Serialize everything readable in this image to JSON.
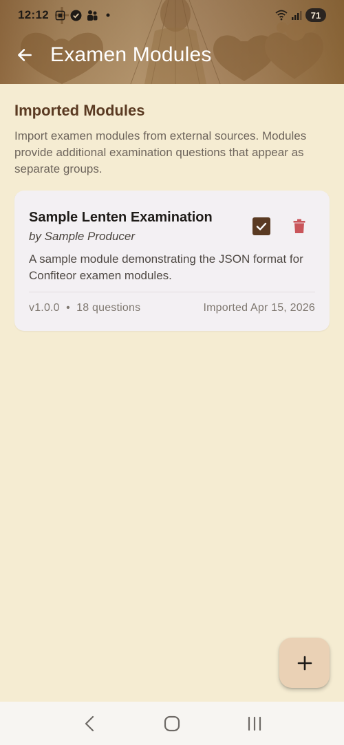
{
  "status_bar": {
    "time": "12:12",
    "battery": "71",
    "icons_left": [
      "screenshot-icon",
      "check-circle-icon",
      "people-icon",
      "dot-icon"
    ],
    "icons_right": [
      "wifi-icon",
      "signal-icon",
      "battery-icon"
    ]
  },
  "app_bar": {
    "title": "Examen Modules",
    "back_icon": "arrow-left-icon"
  },
  "section": {
    "title": "Imported Modules",
    "description": "Import examen modules from external sources. Modules provide additional examination questions that appear as separate groups."
  },
  "modules": [
    {
      "title": "Sample Lenten Examination",
      "author": "by Sample Producer",
      "description": "A sample module demonstrating the JSON format for Confiteor examen modules.",
      "meta_left": "v1.0.0  •  18 questions",
      "meta_right": "Imported Apr 15, 2026",
      "enabled": true
    }
  ],
  "fab": {
    "icon": "plus-icon"
  },
  "nav_bar": {
    "icons": [
      "back-icon",
      "home-icon",
      "recents-icon"
    ]
  },
  "colors": {
    "background": "#f5ecd2",
    "accent": "#5a3a22",
    "delete": "#c9555a",
    "card": "#f3f0f3",
    "fab": "#ead1b5"
  }
}
